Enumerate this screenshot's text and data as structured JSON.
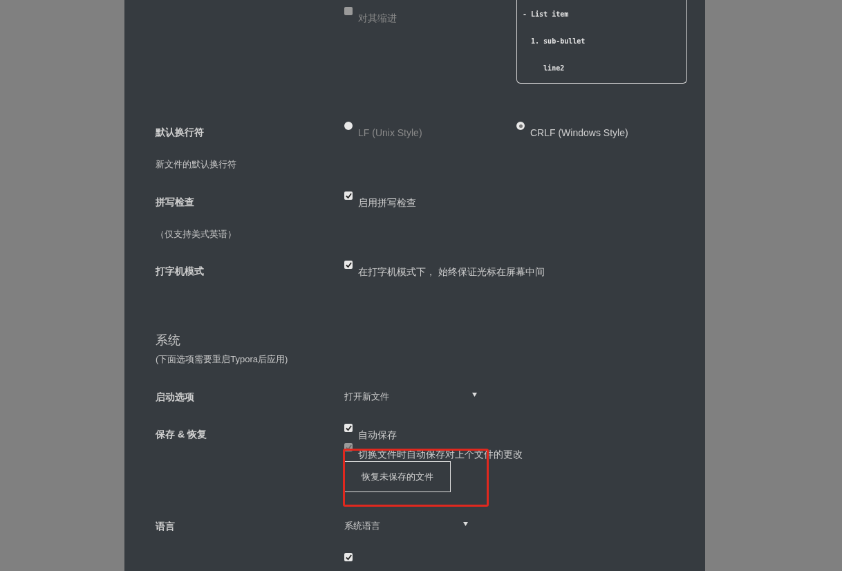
{
  "indent_row": {
    "option": {
      "label": "对其缩进",
      "checked": false,
      "disabled": true
    },
    "preview_lines": [
      "- List item",
      "  1. sub-bullet",
      "     line2"
    ]
  },
  "editor_rows": [
    {
      "label": "默认换行符",
      "kind": "radio",
      "options": [
        {
          "label": "LF (Unix Style)",
          "selected": false
        },
        {
          "label": "CRLF (Windows Style)",
          "selected": true
        }
      ],
      "description": "新文件的默认换行符"
    },
    {
      "label": "拼写检查",
      "kind": "checkbox",
      "options": [
        {
          "label": "启用拼写检查",
          "checked": true,
          "disabled": false
        }
      ],
      "description": "（仅支持美式英语）"
    },
    {
      "label": "打字机模式",
      "kind": "checkbox",
      "options": [
        {
          "label": "在打字机模式下， 始终保证光标在屏幕中间",
          "checked": true,
          "disabled": false
        }
      ]
    }
  ],
  "system_section": {
    "title": "系统",
    "subtitle": "(下面选项需要重启Typora后应用)"
  },
  "system_rows": [
    {
      "label": "启动选项",
      "kind": "select",
      "value": "打开新文件"
    },
    {
      "label": "保存 & 恢复",
      "kind": "checkbox",
      "options": [
        {
          "label": "自动保存",
          "checked": true,
          "disabled": false
        },
        {
          "label": "切换文件时自动保存对上个文件的更改",
          "checked": true,
          "disabled": true
        }
      ],
      "button": {
        "label": "恢复未保存的文件",
        "highlighted": true
      }
    },
    {
      "label": "语言",
      "kind": "select",
      "value": "系统语言"
    },
    {
      "kind": "checkbox",
      "options": [
        {
          "checked": true,
          "disabled": false
        }
      ]
    }
  ]
}
